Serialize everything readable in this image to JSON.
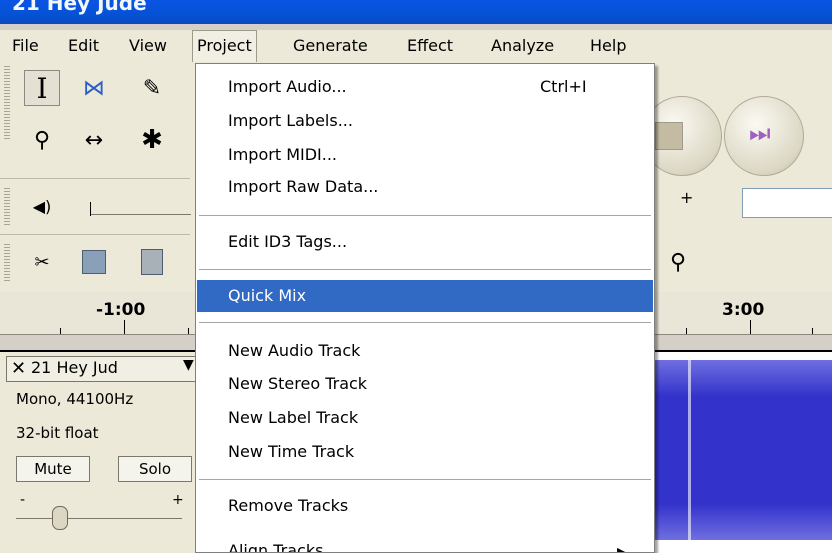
{
  "window": {
    "title": "21 Hey Jude"
  },
  "menubar": {
    "items": [
      "File",
      "Edit",
      "View",
      "Project",
      "Generate",
      "Effect",
      "Analyze",
      "Help"
    ],
    "active": "Project"
  },
  "project_menu": {
    "import_audio": "Import Audio...",
    "import_audio_shortcut": "Ctrl+I",
    "import_labels": "Import Labels...",
    "import_midi": "Import MIDI...",
    "import_raw": "Import Raw Data...",
    "edit_id3": "Edit ID3 Tags...",
    "quick_mix": "Quick Mix",
    "new_audio_track": "New Audio Track",
    "new_stereo_track": "New Stereo Track",
    "new_label_track": "New Label Track",
    "new_time_track": "New Time Track",
    "remove_tracks": "Remove Tracks",
    "align_tracks_partial": "Align Tracks",
    "align_tracks_shortcut_partial": "▸"
  },
  "timeline": {
    "left_label": "-1:00",
    "right_label": "3:00"
  },
  "track": {
    "name": "21 Hey Jud",
    "close_glyph": "✕",
    "menu_glyph": "▼",
    "format": "Mono, 44100Hz",
    "bit_depth": "32-bit float",
    "mute_label": "Mute",
    "solo_label": "Solo",
    "gain_minus": "-",
    "gain_plus": "+"
  },
  "toolbar": {
    "selection_tool_glyph": "I",
    "envelope_tool_glyph": "⋈",
    "draw_tool_glyph": "✎",
    "zoom_tool_glyph": "⚲",
    "timeshift_tool_glyph": "↔",
    "multi_tool_glyph": "✱",
    "volume_glyph": "◀)",
    "meter_plus": "+",
    "skip_end_glyph": "⏭"
  },
  "colors": {
    "titlebar": "#0a54e4",
    "menu_highlight": "#316ac5",
    "waveform": "#3333cc"
  }
}
